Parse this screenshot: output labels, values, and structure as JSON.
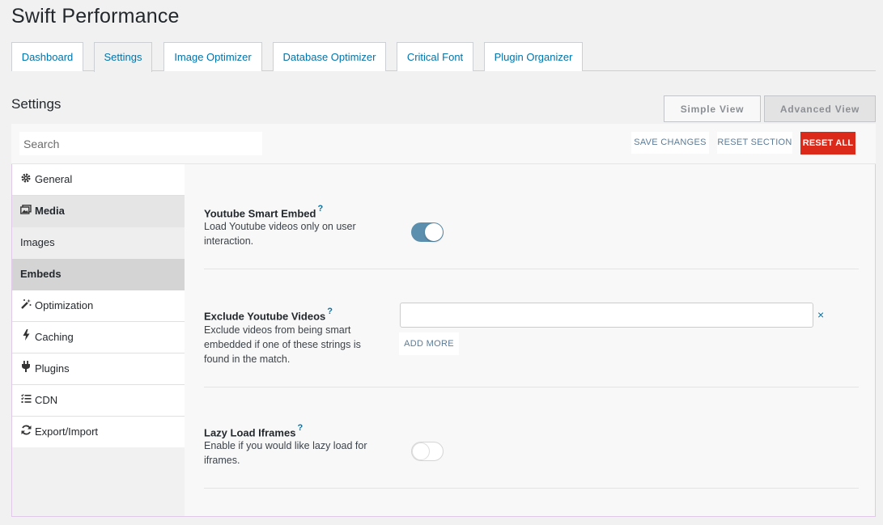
{
  "app": {
    "title": "Swift Performance"
  },
  "tabs": [
    {
      "label": "Dashboard",
      "active": false
    },
    {
      "label": "Settings",
      "active": true
    },
    {
      "label": "Image Optimizer",
      "active": false
    },
    {
      "label": "Database Optimizer",
      "active": false
    },
    {
      "label": "Critical Font",
      "active": false
    },
    {
      "label": "Plugin Organizer",
      "active": false
    }
  ],
  "settings": {
    "title": "Settings",
    "simple_view": "Simple View",
    "advanced_view": "Advanced View"
  },
  "toolbar": {
    "search_placeholder": "Search",
    "save_changes": "SAVE CHANGES",
    "reset_section": "RESET SECTION",
    "reset_all": "RESET ALL",
    "reset_all_color": "#dc2a1a"
  },
  "sidebar": {
    "items": [
      {
        "label": "General",
        "icon": "gear-icon"
      },
      {
        "label": "Media",
        "icon": "media-icon"
      },
      {
        "label": "Images",
        "icon": ""
      },
      {
        "label": "Embeds",
        "icon": ""
      },
      {
        "label": "Optimization",
        "icon": "magic-wand-icon"
      },
      {
        "label": "Caching",
        "icon": "lightning-icon"
      },
      {
        "label": "Plugins",
        "icon": "plug-icon"
      },
      {
        "label": "CDN",
        "icon": "list-icon"
      },
      {
        "label": "Export/Import",
        "icon": "refresh-icon"
      }
    ]
  },
  "options": {
    "youtube_smart_embed": {
      "title": "Youtube Smart Embed",
      "help": "?",
      "description": "Load Youtube videos only on user interaction.",
      "enabled": true
    },
    "exclude_youtube_videos": {
      "title": "Exclude Youtube Videos",
      "help": "?",
      "description": "Exclude videos from being smart embedded if one of these strings is found in the match.",
      "value": "",
      "remove_label": "×",
      "add_more": "ADD MORE"
    },
    "lazy_load_iframes": {
      "title": "Lazy Load Iframes",
      "help": "?",
      "description": "Enable if you would like lazy load for iframes.",
      "enabled": false
    }
  },
  "colors": {
    "accent": "#0073aa",
    "toggle_on": "#5b8fad"
  }
}
